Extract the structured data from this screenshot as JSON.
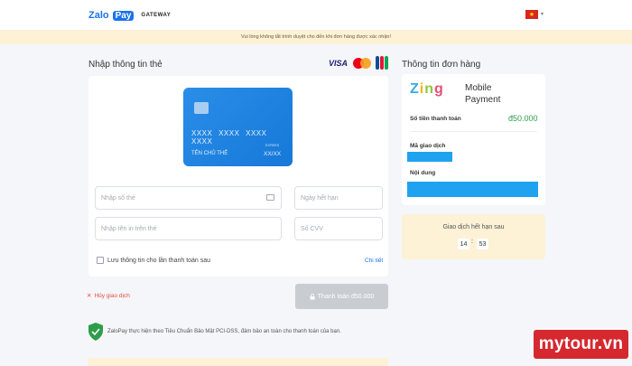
{
  "header": {
    "logo_zalo": "Zalo",
    "logo_pay": "Pay",
    "logo_gateway": "GATEWAY",
    "flag_icon": "vietnam-flag-icon",
    "flag_star": "★",
    "lang_caret": "▾"
  },
  "notice": {
    "text": "Vui lòng không tắt trình duyệt cho đến khi đơn hàng được xác nhận!"
  },
  "card_form": {
    "title": "Nhập thông tin thẻ",
    "brands": [
      "VISA",
      "MasterCard",
      "JCB"
    ],
    "visa_label": "VISA",
    "preview": {
      "number": "XXXX XXXX XXXX XXXX",
      "holder": "TÊN CHỦ THẺ",
      "expiry_label": "EXPIRES",
      "expiry": "XX/XX"
    },
    "card_number_placeholder": "Nhập số thẻ",
    "expiry_placeholder": "Ngày hết hạn",
    "name_placeholder": "Nhập tên in trên thẻ",
    "cvv_placeholder": "Số CVV",
    "save_label": "Lưu thông tin cho lần thanh toán sau",
    "save_checked": false,
    "detail_link": "Chi tiết",
    "cancel_label": "Hủy giao dịch",
    "cancel_icon": "✕",
    "pay_label": "Thanh toán đ50.000",
    "pay_icon": "lock-icon",
    "pci_text": "ZaloPay thực hiện theo Tiêu Chuẩn Bảo Mật PCI-DSS, đảm bảo an toàn cho thanh toán của bạn."
  },
  "order": {
    "title": "Thông tin đơn hàng",
    "merchant_logo": [
      "Z",
      "i",
      "n",
      "g"
    ],
    "merchant_name": "Mobile Payment",
    "amount_label": "Số tiền thanh toán",
    "amount": "đ50.000",
    "transaction_label": "Mã giao dịch",
    "content_label": "Nội dung"
  },
  "expiry_timer": {
    "label": "Giao dịch hết hạn sau",
    "minutes": "14",
    "separator": ":",
    "seconds": "53"
  },
  "watermark": {
    "text": "mytour.vn"
  },
  "colors": {
    "primary": "#1a73e8",
    "card_blue": "#1678d8",
    "success": "#2e9d4a",
    "danger": "#e74c3c",
    "notice_bg": "#fdf1d6",
    "redacted": "#1fa3f0"
  }
}
